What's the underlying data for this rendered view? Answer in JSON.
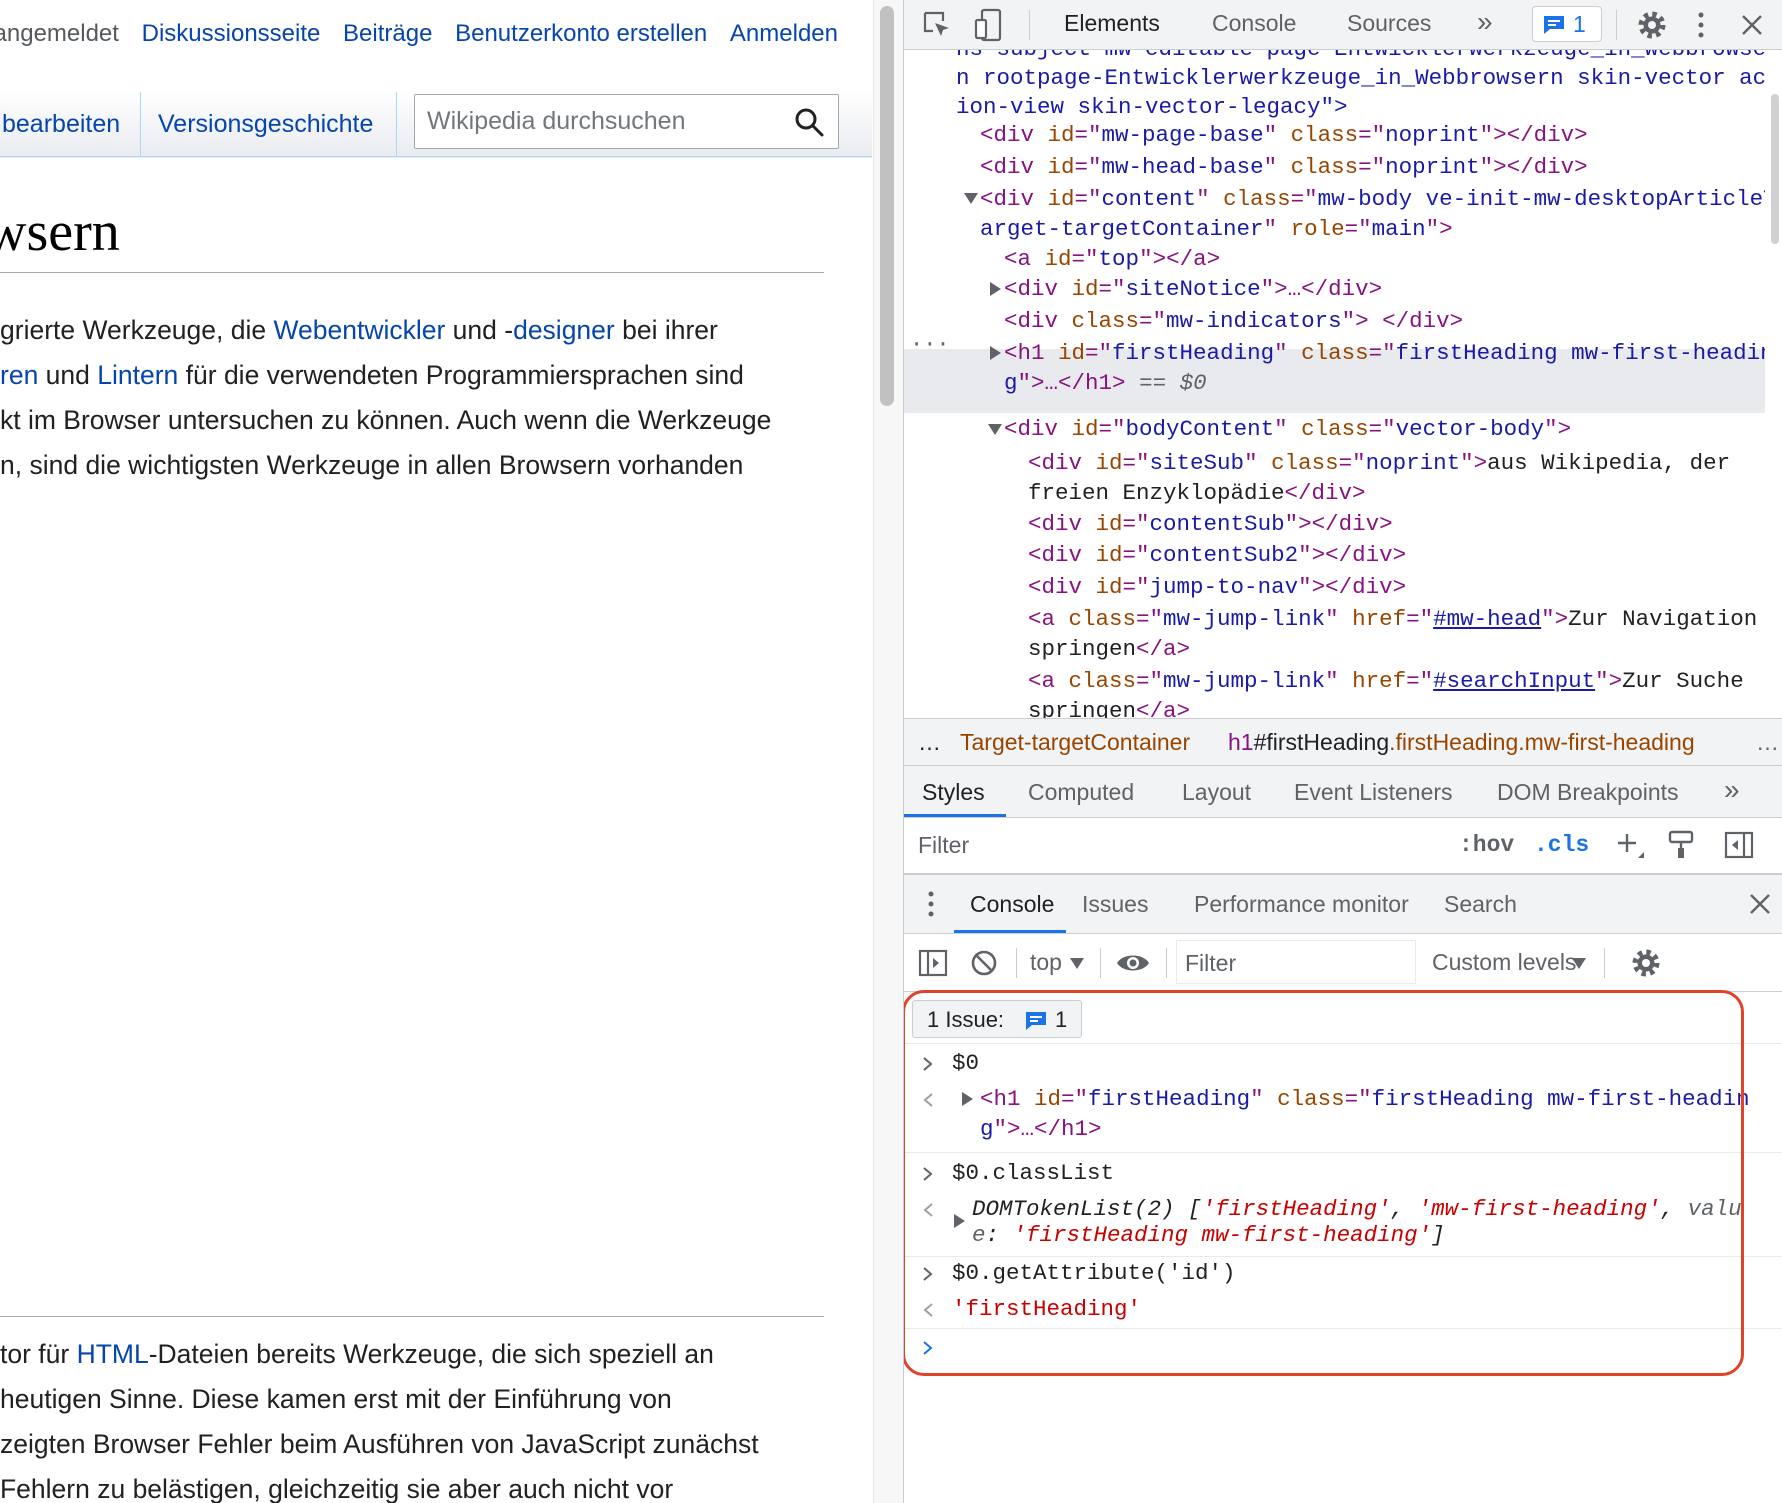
{
  "wiki": {
    "personal": {
      "status": "t angemeldet",
      "links": [
        "Diskussionsseite",
        "Beiträge",
        "Benutzerkonto erstellen",
        "Anmelden"
      ]
    },
    "tabs": {
      "edit": "bearbeiten",
      "history": "Versionsgeschichte"
    },
    "search_placeholder": "Wikipedia durchsuchen",
    "title": "wsern",
    "intro": [
      {
        "a": "grierte Werkzeuge, die ",
        "l1": "Webentwickler",
        "b": " und -",
        "l2": "designer",
        "c": " bei ihrer"
      },
      {
        "l0": "ren",
        "a": " und ",
        "l1": "Lintern",
        "b": " für die verwendeten Programmiersprachen sind"
      },
      {
        "a": "kt im Browser untersuchen zu können. Auch wenn die Werkzeuge"
      },
      {
        "a": "n, sind die wichtigsten Werkzeuge in allen Browsern vorhanden"
      }
    ],
    "section": [
      {
        "a": "tor für ",
        "l1": "HTML",
        "b": "-Dateien bereits Werkzeuge, die sich speziell an"
      },
      {
        "a": "heutigen Sinne. Diese kamen erst mit der Einführung von"
      },
      {
        "a": " zeigten Browser Fehler beim Ausführen von JavaScript zunächst"
      },
      {
        "a": "Fehlern zu belästigen, gleichzeitig sie aber auch nicht vor"
      }
    ]
  },
  "devtools": {
    "top_tabs": [
      "Elements",
      "Console",
      "Sources"
    ],
    "more": "»",
    "issues_count": "1",
    "dom": {
      "l0": "ns-subject mw-editable page-Entwicklerwerkzeuge_in_Webbrowser",
      "l1": "n rootpage-Entwicklerwerkzeuge_in_Webbrowsern skin-vector act",
      "l2": "ion-view skin-vector-legacy\">",
      "page_base": [
        "<div ",
        "id",
        "=\"",
        "mw-page-base",
        "\" ",
        "class",
        "=\"",
        "noprint",
        "\"></div>"
      ],
      "head_base_id": "mw-head-base",
      "content_class_1": "mw-body ve-init-mw-desktopArticleT",
      "content_class_2": "arget-targetContainer",
      "role": "main",
      "top_id": "top",
      "siteNotice": "siteNotice",
      "indicators": "mw-indicators",
      "h1_class_1": "firstHeading mw-first-headin",
      "h1_class_2": "g",
      "h1_id": "firstHeading",
      "eq": "== $0",
      "body_id": "bodyContent",
      "body_class": "vector-body",
      "siteSub_text_1": "aus Wikipedia, der",
      "siteSub_text_2": "freien Enzyklopädie",
      "siteSub": "siteSub",
      "contentSub": "contentSub",
      "contentSub2": "contentSub2",
      "jump_to_nav": "jump-to-nav",
      "jump_link": "mw-jump-link",
      "href1": "#mw-head",
      "text1a": "Zur Navigation",
      "text1b": "springen",
      "href2": "#searchInput",
      "text2a": "Zur Suche",
      "text2b": "springen"
    },
    "breadcrumb": {
      "ellipsis": "…",
      "c1": "Target-targetContainer",
      "c2_tag": "h1",
      "c2_id": "#firstHeading",
      "c2_cls": ".firstHeading.mw-first-heading",
      "trail": "…"
    },
    "style_tabs": [
      "Styles",
      "Computed",
      "Layout",
      "Event Listeners",
      "DOM Breakpoints"
    ],
    "filter_placeholder": "Filter",
    "hov": ":hov",
    "cls": ".cls",
    "drawer_tabs": [
      "Console",
      "Issues",
      "Performance monitor",
      "Search"
    ],
    "context": "top",
    "console_filter": "Filter",
    "levels": "Custom levels",
    "issue_label": "1 Issue:",
    "issue_count": "1",
    "console": {
      "in1": "$0",
      "out1_a": "firstHeading",
      "out1_b": "firstHeading mw-first-headin",
      "in2": "$0.classList",
      "out2_type": "DOMTokenList(2)",
      "out2_v1": "'firstHeading'",
      "out2_v2": "'mw-first-heading'",
      "out2_key1": "valu",
      "out2_key2": "e",
      "out2_value": "'firstHeading mw-first-heading'",
      "in3": "$0.getAttribute('id')",
      "out3": "'firstHeading'"
    }
  }
}
